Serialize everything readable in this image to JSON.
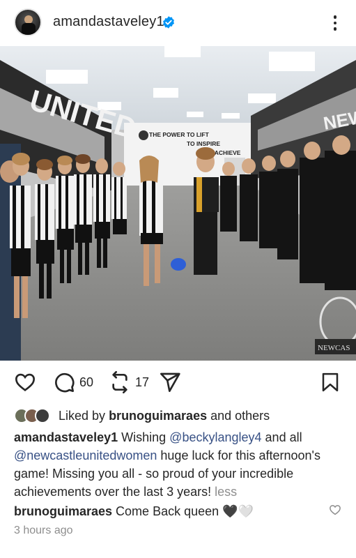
{
  "post": {
    "username": "amandastaveley1",
    "verified_icon": "verified-badge-icon",
    "more_icon": "more-options-icon"
  },
  "photo": {
    "banner_line1": "THE POWER TO LIFT",
    "banner_line2": "TO INSPIRE",
    "banner_line3": "TO ACHIEVE",
    "wall_left_text": "UNITED",
    "wall_right_text": "NEW",
    "crest_text": "NEWCAS"
  },
  "actions": {
    "comments_count": "60",
    "reposts_count": "17",
    "like_icon": "heart-icon",
    "comment_icon": "comment-icon",
    "repost_icon": "repost-icon",
    "share_icon": "send-icon",
    "save_icon": "bookmark-icon"
  },
  "likes": {
    "prefix": "Liked by",
    "user": "brunoguimaraes",
    "suffix": "and others"
  },
  "caption": {
    "user": "amandastaveley1",
    "text_1": "Wishing",
    "mention_1": "@beckylangley4",
    "text_2": "and all",
    "mention_2": "@newcastleunitedwomen",
    "text_3": "huge luck for this afternoon's game! Missing you all - so proud of your incredible achievements over the last 3 years!",
    "less": "less"
  },
  "comment": {
    "user": "brunoguimaraes",
    "text": "Come Back queen 🖤🤍"
  },
  "timestamp": "3 hours ago",
  "colors": {
    "text": "#262626",
    "mention": "#385185",
    "muted": "#8e8e8e",
    "verified": "#0095f6"
  }
}
